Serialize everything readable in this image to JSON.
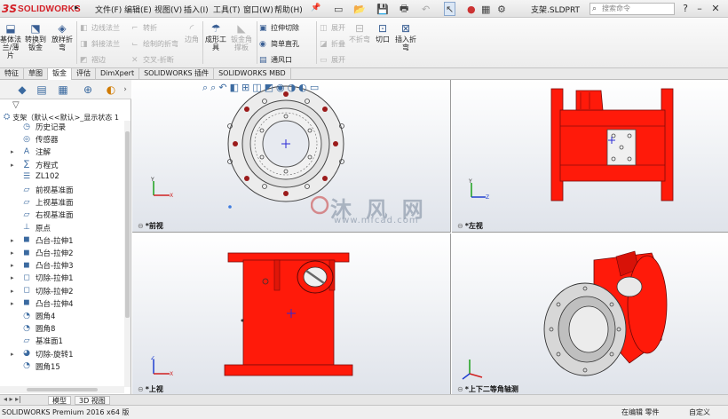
{
  "app": {
    "logo_mark": "3S",
    "logo_text": "SOLIDWORKS",
    "document_title": "支架.SLDPRT"
  },
  "menu": [
    "文件(F)",
    "编辑(E)",
    "视图(V)",
    "插入(I)",
    "工具(T)",
    "窗口(W)",
    "帮助(H)"
  ],
  "search": {
    "placeholder": "搜索命令"
  },
  "ribbon": {
    "big_buttons": [
      {
        "label": "基体法兰/薄片",
        "icon": "sheetmetal-icon"
      },
      {
        "label": "转换到钣金",
        "icon": "convert-icon"
      },
      {
        "label": "放样折弯",
        "icon": "loft-bend-icon"
      },
      {
        "label": "边角",
        "icon": "corner-icon"
      },
      {
        "label": "成形工具",
        "icon": "forming-tool-icon"
      },
      {
        "label": "钣金角撑板",
        "icon": "gusset-icon"
      },
      {
        "label": "不折弯",
        "icon": "no-bend-icon"
      },
      {
        "label": "切口",
        "icon": "rip-icon"
      },
      {
        "label": "插入折弯",
        "icon": "insert-bend-icon"
      }
    ],
    "small_buttons": {
      "col1": [
        "边线法兰",
        "斜接法兰",
        "褶边"
      ],
      "col2": [
        "转折",
        "绘制的折弯",
        "交叉-折断"
      ],
      "col3": [
        "拉伸切除",
        "简单直孔",
        "通风口"
      ],
      "col4": [
        "展开",
        "折叠",
        "展开"
      ]
    }
  },
  "tabs": [
    "特征",
    "草图",
    "钣金",
    "评估",
    "DimXpert",
    "SOLIDWORKS 插件",
    "SOLIDWORKS MBD"
  ],
  "tree": {
    "root": "支架（默认<<默认>_显示状态 1",
    "items": [
      {
        "label": "历史记录",
        "icon": "history-icon"
      },
      {
        "label": "传感器",
        "icon": "sensor-icon"
      },
      {
        "label": "注解",
        "icon": "annotation-icon"
      },
      {
        "label": "方程式",
        "icon": "equation-icon"
      },
      {
        "label": "ZL102",
        "icon": "material-icon"
      },
      {
        "label": "前视基准面",
        "icon": "plane-icon"
      },
      {
        "label": "上视基准面",
        "icon": "plane-icon"
      },
      {
        "label": "右视基准面",
        "icon": "plane-icon"
      },
      {
        "label": "原点",
        "icon": "origin-icon"
      },
      {
        "label": "凸台-拉伸1",
        "icon": "boss-extrude-icon"
      },
      {
        "label": "凸台-拉伸2",
        "icon": "boss-extrude-icon"
      },
      {
        "label": "凸台-拉伸3",
        "icon": "boss-extrude-icon"
      },
      {
        "label": "切除-拉伸1",
        "icon": "cut-extrude-icon"
      },
      {
        "label": "切除-拉伸2",
        "icon": "cut-extrude-icon"
      },
      {
        "label": "凸台-拉伸4",
        "icon": "boss-extrude-icon"
      },
      {
        "label": "圆角4",
        "icon": "fillet-icon"
      },
      {
        "label": "圆角8",
        "icon": "fillet-icon"
      },
      {
        "label": "基准面1",
        "icon": "plane-icon"
      },
      {
        "label": "切除-旋转1",
        "icon": "cut-revolve-icon"
      },
      {
        "label": "圆角15",
        "icon": "fillet-icon"
      }
    ]
  },
  "viewports": {
    "front": "*前视",
    "left": "*左视",
    "top": "*上视",
    "iso": "*上下二等角轴测"
  },
  "bottom_tabs": [
    "模型",
    "3D 视图"
  ],
  "status": {
    "left": "SOLIDWORKS Premium 2016 x64 版",
    "editing": "在编辑 零件",
    "custom": "自定义"
  },
  "watermark": {
    "text": "沐 风 网",
    "url": "www.mfcad.com"
  },
  "colors": {
    "part_red": "#ff1a0a",
    "part_gray": "#c8c8c8",
    "accent": "#3b6aa0",
    "brand": "#d42027"
  }
}
